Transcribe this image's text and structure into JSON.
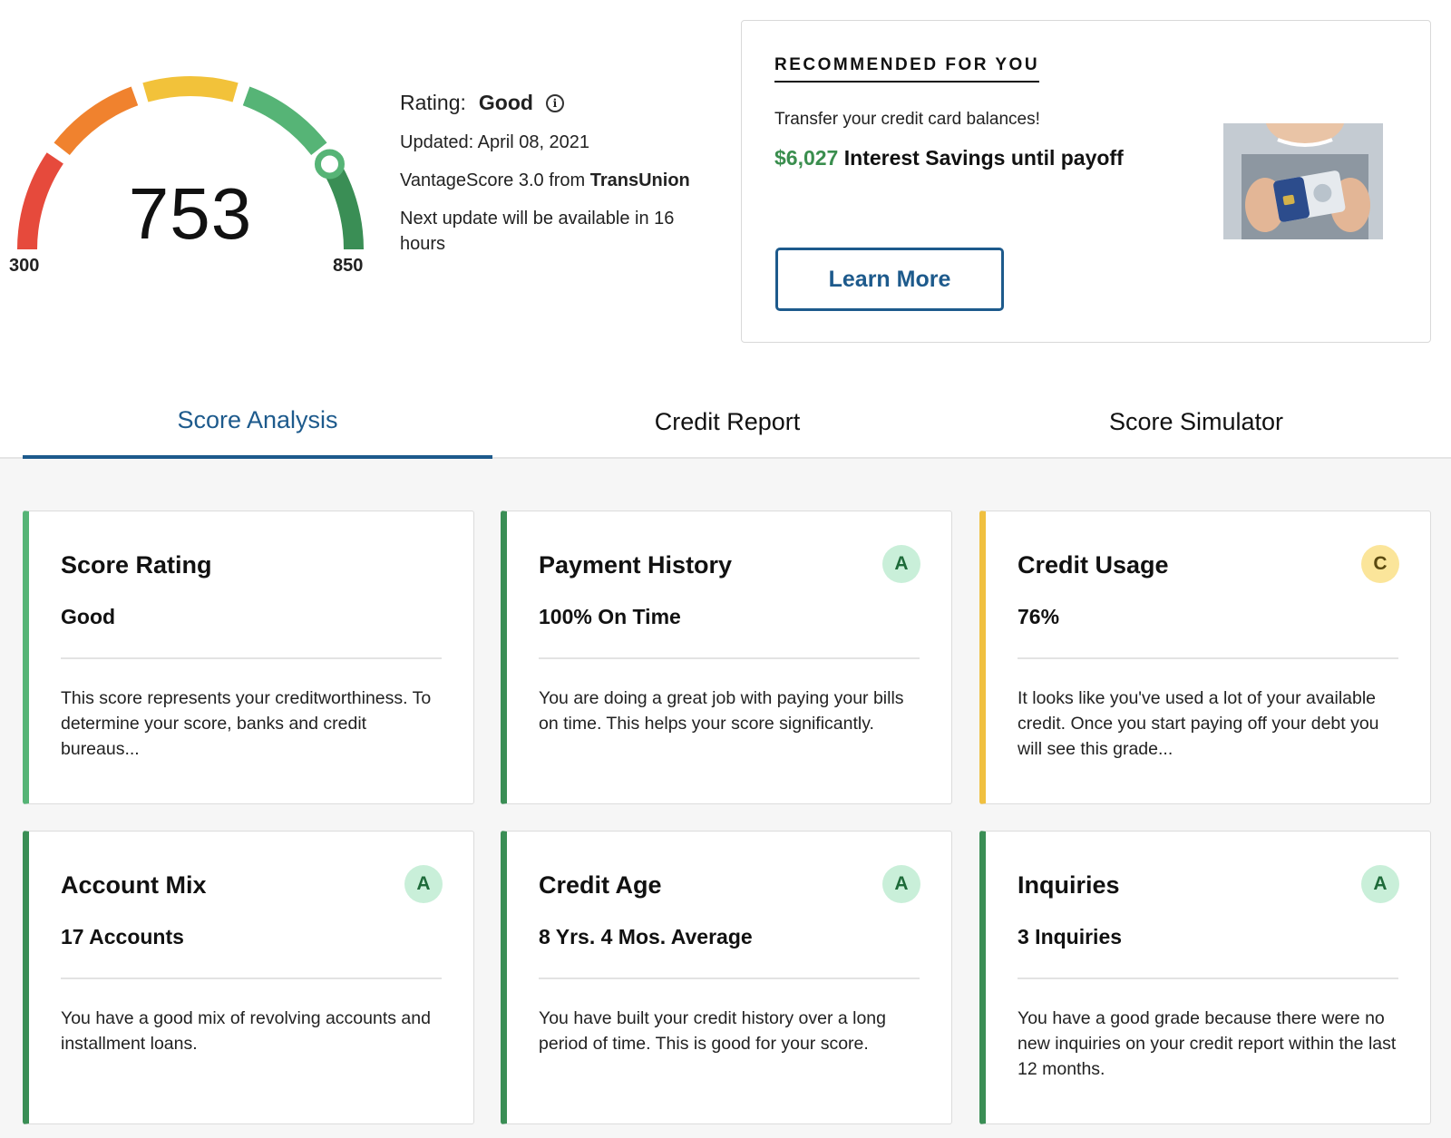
{
  "colors": {
    "primary_blue": "#1d5a8c",
    "good_green": "#3a8e4e",
    "warning_yellow": "#f0c040",
    "gauge_segments": [
      "#e64a3c",
      "#f0822e",
      "#f2c23a",
      "#56b476",
      "#3a8e55"
    ]
  },
  "score": {
    "value": "753",
    "min": "300",
    "max": "850",
    "percent_of_range": 0.825,
    "rating_label": "Rating:",
    "rating_value": "Good",
    "updated": "Updated: April 08, 2021",
    "source_prefix": "VantageScore 3.0 from ",
    "source_bureau": "TransUnion",
    "next_update": "Next update will be available in 16 hours"
  },
  "recommendation": {
    "heading": "RECOMMENDED FOR YOU",
    "text": "Transfer your credit card balances!",
    "savings_amount": "$6,027",
    "savings_label": " Interest Savings until payoff",
    "button_label": "Learn More"
  },
  "tabs": [
    {
      "label": "Score Analysis",
      "active": true
    },
    {
      "label": "Credit Report",
      "active": false
    },
    {
      "label": "Score Simulator",
      "active": false
    }
  ],
  "cards": [
    {
      "title": "Score Rating",
      "value": "Good",
      "grade": "",
      "accent": "#56b476",
      "desc": "This score represents your creditworthiness. To determine your score, banks and credit bureaus..."
    },
    {
      "title": "Payment History",
      "value": "100% On Time",
      "grade": "A",
      "accent": "#3a8e55",
      "desc": "You are doing a great job with paying your bills on time. This helps your score significantly."
    },
    {
      "title": "Credit Usage",
      "value": "76%",
      "grade": "C",
      "accent": "#f0c040",
      "desc": "It looks like you've used a lot of your available credit. Once you start paying off your debt you will see this grade..."
    },
    {
      "title": "Account Mix",
      "value": "17 Accounts",
      "grade": "A",
      "accent": "#3a8e55",
      "desc": "You have a good mix of revolving accounts and installment loans."
    },
    {
      "title": "Credit Age",
      "value": "8 Yrs. 4 Mos. Average",
      "grade": "A",
      "accent": "#3a8e55",
      "desc": "You have built your credit history over a long period of time. This is good for your score."
    },
    {
      "title": "Inquiries",
      "value": "3 Inquiries",
      "grade": "A",
      "accent": "#3a8e55",
      "desc": "You have a good grade because there were no new inquiries on your credit report within the last 12 months."
    }
  ]
}
